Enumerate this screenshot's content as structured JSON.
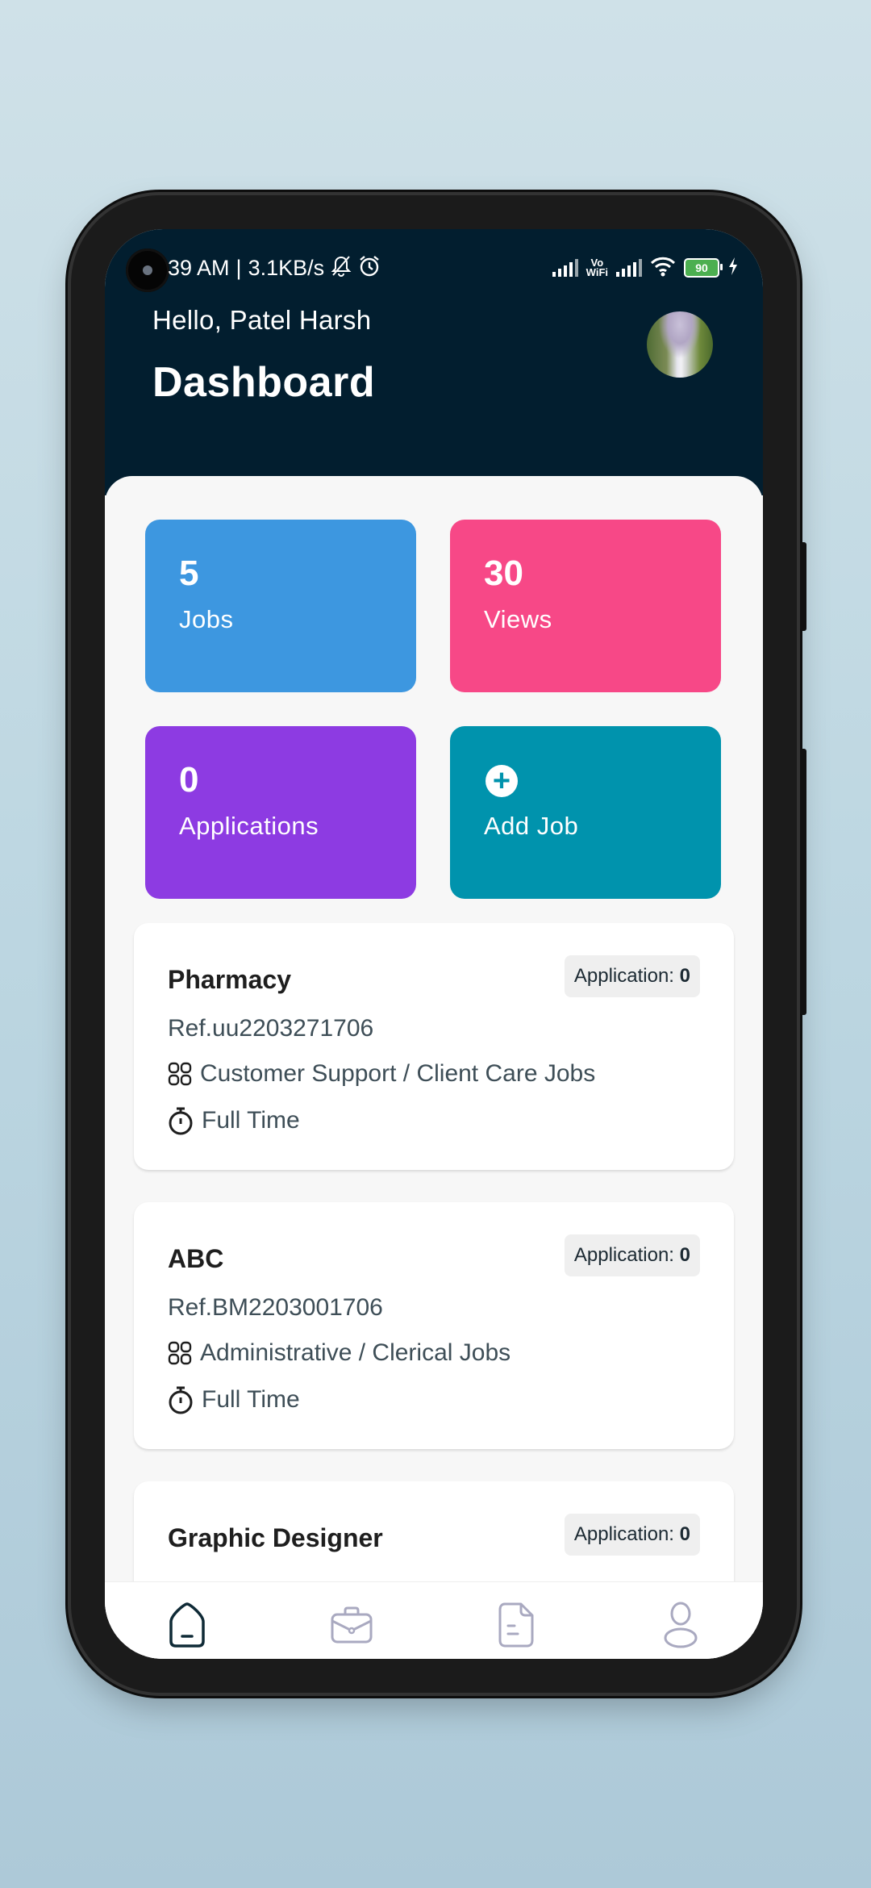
{
  "status_bar": {
    "time": "39 AM",
    "separator": "|",
    "speed": "3.1KB/s",
    "icons": [
      "bell-off-icon",
      "alarm-icon",
      "signal-icon",
      "vowifi-icon",
      "signal-icon",
      "wifi-icon",
      "battery-icon",
      "charging-icon"
    ],
    "vowifi_top": "Vo",
    "vowifi_bottom": "WiFi",
    "battery": "90"
  },
  "header": {
    "greeting": "Hello, Patel Harsh",
    "title": "Dashboard",
    "avatar": "profile-photo-waterfall"
  },
  "stats": [
    {
      "value": "5",
      "label": "Jobs",
      "color": "#3d97e0"
    },
    {
      "value": "30",
      "label": "Views",
      "color": "#f74887"
    },
    {
      "value": "0",
      "label": "Applications",
      "color": "#8d3be2"
    },
    {
      "value": "",
      "label": "Add Job",
      "color": "#0093ad",
      "icon": "plus-circle-icon"
    }
  ],
  "jobs": [
    {
      "title": "Pharmacy",
      "application_label": "Application:",
      "application_count": "0",
      "ref": "Ref.uu2203271706",
      "category": "Customer Support / Client Care Jobs",
      "type": "Full Time"
    },
    {
      "title": "ABC",
      "application_label": "Application:",
      "application_count": "0",
      "ref": "Ref.BM2203001706",
      "category": "Administrative / Clerical Jobs",
      "type": "Full Time"
    },
    {
      "title": "Graphic Designer",
      "application_label": "Application:",
      "application_count": "0"
    }
  ],
  "bottom_nav": [
    {
      "name": "home",
      "icon": "home-icon",
      "active": true
    },
    {
      "name": "jobs",
      "icon": "briefcase-icon",
      "active": false
    },
    {
      "name": "applications",
      "icon": "document-icon",
      "active": false
    },
    {
      "name": "profile",
      "icon": "user-icon",
      "active": false
    }
  ],
  "colors": {
    "header_bg": "#021e2f",
    "nav_active": "#0f2a36",
    "nav_inactive": "#a9a9c0"
  }
}
